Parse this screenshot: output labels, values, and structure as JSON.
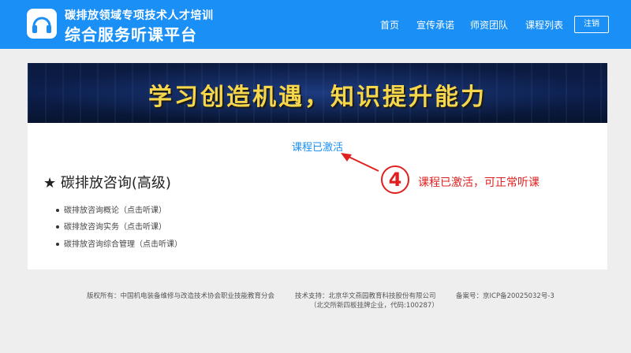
{
  "header": {
    "logo_icon": "headphones-icon",
    "brand_line1": "碳排放领域专项技术人才培训",
    "brand_line2": "综合服务听课平台",
    "nav": [
      "首页",
      "宣传承诺",
      "师资团队",
      "课程列表"
    ],
    "logout_label": "注销",
    "bg_color": "#1a8ff5"
  },
  "banner": {
    "text": "学习创造机遇，知识提升能力"
  },
  "main": {
    "activated_text": "课程已激活",
    "course_title": "★ 碳排放咨询(高级)",
    "lessons": [
      "碳排放咨询概论（点击听课）",
      "碳排放咨询实务（点击听课）",
      "碳排放咨询综合管理（点击听课）"
    ]
  },
  "annotation": {
    "number": "4",
    "text": "课程已激活，可正常听课",
    "color": "#e02020"
  },
  "footer": {
    "copyright": "版权所有：中国机电装备维修与改造技术协会职业技能教育分会",
    "tech_support": "技术支持：北京华文燕园教育科技股份有限公司",
    "tech_support_note": "（北交所新四板挂牌企业，代码:100287）",
    "icp": "备案号：京ICP备20025032号-3"
  }
}
